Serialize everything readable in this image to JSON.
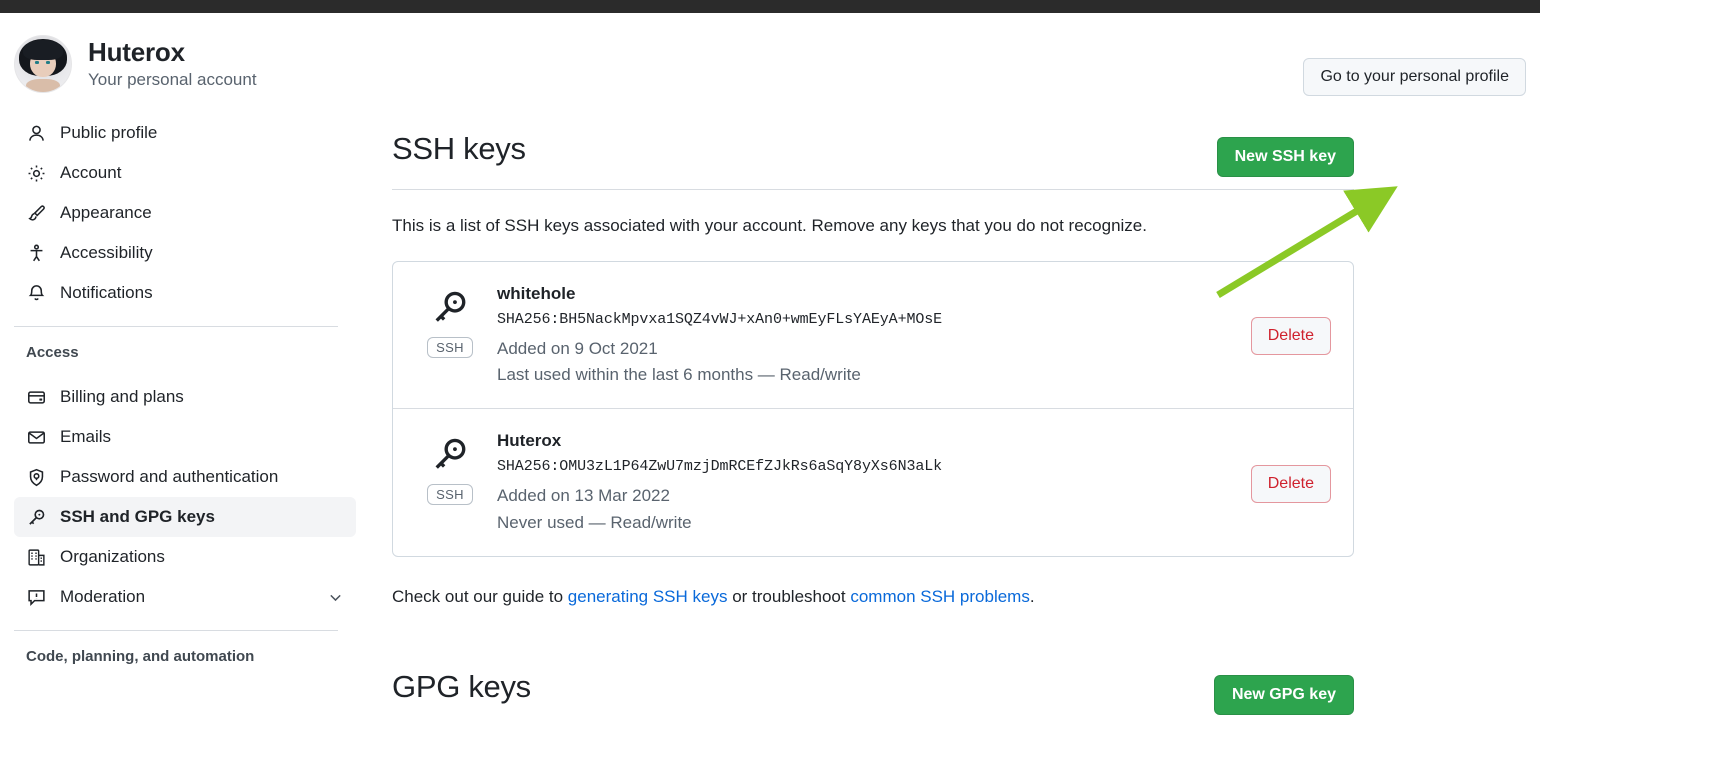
{
  "profile": {
    "name": "Huterox",
    "subtitle": "Your personal account",
    "avatar_alt": "user-avatar"
  },
  "header": {
    "go_personal_profile": "Go to your personal profile"
  },
  "sidebar": {
    "items": [
      {
        "label": "Public profile",
        "icon": "person-icon",
        "selected": false
      },
      {
        "label": "Account",
        "icon": "gear-icon",
        "selected": false
      },
      {
        "label": "Appearance",
        "icon": "paintbrush-icon",
        "selected": false
      },
      {
        "label": "Accessibility",
        "icon": "accessibility-icon",
        "selected": false
      },
      {
        "label": "Notifications",
        "icon": "bell-icon",
        "selected": false
      }
    ],
    "access_group_title": "Access",
    "access_items": [
      {
        "label": "Billing and plans",
        "icon": "credit-card-icon",
        "selected": false
      },
      {
        "label": "Emails",
        "icon": "mail-icon",
        "selected": false
      },
      {
        "label": "Password and authentication",
        "icon": "shield-lock-icon",
        "selected": false
      },
      {
        "label": "SSH and GPG keys",
        "icon": "key-icon",
        "selected": true
      },
      {
        "label": "Organizations",
        "icon": "organization-icon",
        "selected": false
      },
      {
        "label": "Moderation",
        "icon": "report-icon",
        "selected": false,
        "has_chevron": true
      }
    ],
    "code_group_title": "Code, planning, and automation"
  },
  "ssh_section": {
    "title": "SSH keys",
    "new_key_button": "New SSH key",
    "description": "This is a list of SSH keys associated with your account. Remove any keys that you do not recognize.",
    "keys": [
      {
        "name": "whitehole",
        "fingerprint": "SHA256:BH5NackMpvxa1SQZ4vWJ+xAn0+wmEyFLsYAEyA+MOsE",
        "badge": "SSH",
        "added": "Added on 9 Oct 2021",
        "usage": "Last used within the last 6 months — Read/write",
        "delete_label": "Delete"
      },
      {
        "name": "Huterox",
        "fingerprint": "SHA256:OMU3zL1P64ZwU7mzjDmRCEfZJkRs6aSqY8yXs6N3aLk",
        "badge": "SSH",
        "added": "Added on 13 Mar 2022",
        "usage": "Never used — Read/write",
        "delete_label": "Delete"
      }
    ],
    "guide_prefix": "Check out our guide to ",
    "guide_link1": "generating SSH keys",
    "guide_middle": " or troubleshoot ",
    "guide_link2": "common SSH problems",
    "guide_suffix": "."
  },
  "gpg_section": {
    "title": "GPG keys",
    "new_key_button": "New GPG key"
  },
  "colors": {
    "green_button": "#2DA44E",
    "link_blue": "#0969DA",
    "delete_red": "#CF222E",
    "annotation_arrow": "#8BC926"
  }
}
